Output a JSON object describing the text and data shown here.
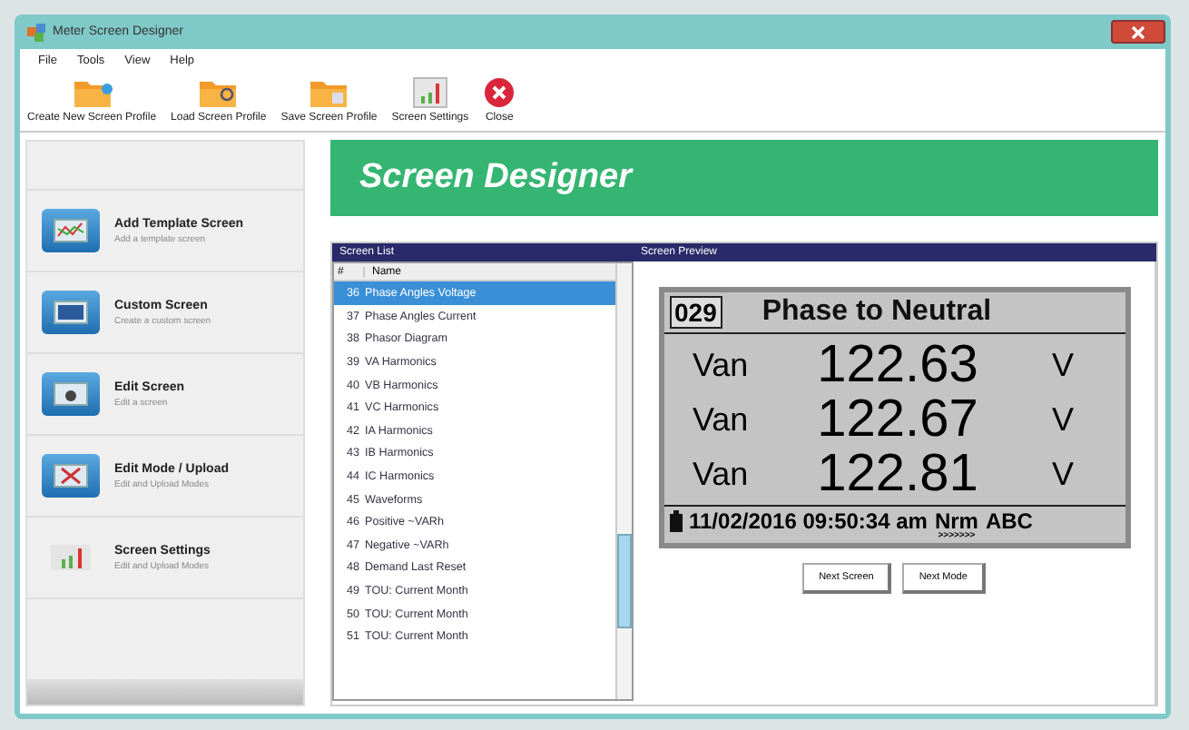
{
  "window": {
    "title": "Meter Screen Designer"
  },
  "menu": [
    "File",
    "Tools",
    "View",
    "Help"
  ],
  "toolbar": [
    "Create New Screen Profile",
    "Load Screen Profile",
    "Save Screen Profile",
    "Screen Settings",
    "Close"
  ],
  "sidebar": {
    "items": [
      {
        "title": "Add Template Screen",
        "subtitle": "Add a template screen",
        "kind": "tile"
      },
      {
        "title": "Custom Screen",
        "subtitle": "Create a custom screen",
        "kind": "tile"
      },
      {
        "title": "Edit Screen",
        "subtitle": "Edit a screen",
        "kind": "tile"
      },
      {
        "title": "Edit Mode / Upload",
        "subtitle": "Edit and Upload Modes",
        "kind": "tile"
      },
      {
        "title": "Screen Settings",
        "subtitle": "Edit and Upload Modes",
        "kind": "plain"
      }
    ]
  },
  "header": "Screen Designer",
  "screen_list": {
    "title": "Screen List",
    "columns": [
      "#",
      "Name"
    ],
    "rows": [
      {
        "num": "36",
        "name": "Phase Angles Voltage",
        "selected": true
      },
      {
        "num": "37",
        "name": "Phase Angles Current",
        "selected": false
      },
      {
        "num": "38",
        "name": "Phasor Diagram",
        "selected": false
      },
      {
        "num": "39",
        "name": "VA Harmonics",
        "selected": false
      },
      {
        "num": "40",
        "name": "VB Harmonics",
        "selected": false
      },
      {
        "num": "41",
        "name": "VC Harmonics",
        "selected": false
      },
      {
        "num": "42",
        "name": "IA Harmonics",
        "selected": false
      },
      {
        "num": "43",
        "name": "IB Harmonics",
        "selected": false
      },
      {
        "num": "44",
        "name": "IC Harmonics",
        "selected": false
      },
      {
        "num": "45",
        "name": "Waveforms",
        "selected": false
      },
      {
        "num": "46",
        "name": "Positive ~VARh",
        "selected": false
      },
      {
        "num": "47",
        "name": "Negative ~VARh",
        "selected": false
      },
      {
        "num": "48",
        "name": "Demand Last Reset",
        "selected": false
      },
      {
        "num": "49",
        "name": "TOU: Current Month",
        "selected": false
      },
      {
        "num": "50",
        "name": "TOU: Current Month",
        "selected": false
      },
      {
        "num": "51",
        "name": "TOU: Current Month",
        "selected": false
      }
    ]
  },
  "preview": {
    "title": "Screen Preview",
    "screen_number": "029",
    "screen_title": "Phase to Neutral",
    "readings": [
      {
        "label": "Van",
        "value": "122.63",
        "unit": "V"
      },
      {
        "label": "Van",
        "value": "122.67",
        "unit": "V"
      },
      {
        "label": "Van",
        "value": "122.81",
        "unit": "V"
      }
    ],
    "status": "11/02/2016  09:50:34  am",
    "mode": "Nrm",
    "phase": "ABC",
    "arrows": ">>>>>>>",
    "buttons": [
      "Next Screen",
      "Next Mode"
    ]
  }
}
